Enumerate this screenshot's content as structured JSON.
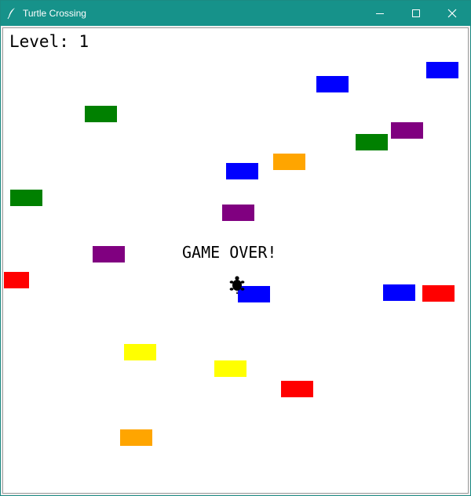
{
  "window": {
    "title": "Turtle Crossing",
    "app_icon": "feather-icon",
    "controls": [
      "minimize-icon",
      "maximize-icon",
      "close-icon"
    ]
  },
  "hud": {
    "level_text": "Level: 1",
    "status_text": "GAME OVER!"
  },
  "colors": {
    "titlebar": "#16928a",
    "canvas_bg": "#ffffff",
    "blue": "#0000ff",
    "green": "#008000",
    "purple": "#800080",
    "orange": "#ffa500",
    "red": "#ff0000",
    "yellow": "#ffff00",
    "turtle": "#000000"
  },
  "cars": [
    {
      "color": "blue"
    },
    {
      "color": "blue"
    },
    {
      "color": "green"
    },
    {
      "color": "purple"
    },
    {
      "color": "green"
    },
    {
      "color": "orange"
    },
    {
      "color": "blue"
    },
    {
      "color": "green"
    },
    {
      "color": "purple"
    },
    {
      "color": "purple"
    },
    {
      "color": "red"
    },
    {
      "color": "blue"
    },
    {
      "color": "blue"
    },
    {
      "color": "red"
    },
    {
      "color": "yellow"
    },
    {
      "color": "yellow"
    },
    {
      "color": "red"
    },
    {
      "color": "orange"
    }
  ],
  "player": {
    "icon": "turtle-icon"
  }
}
